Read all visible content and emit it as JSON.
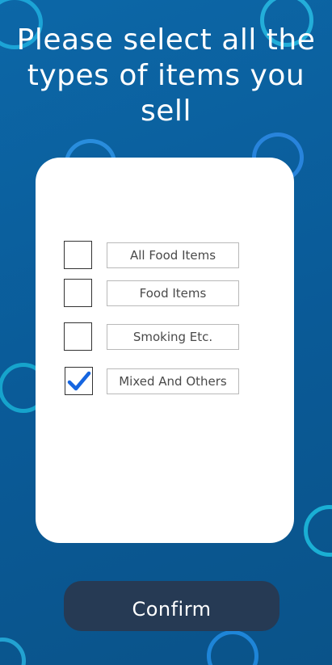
{
  "header": {
    "title": "Please select all the types of items you sell"
  },
  "options": [
    {
      "label": "All Food Items",
      "checked": false
    },
    {
      "label": "Food Items",
      "checked": false
    },
    {
      "label": "Smoking Etc.",
      "checked": false
    },
    {
      "label": "Mixed And Others",
      "checked": true
    }
  ],
  "actions": {
    "confirm_label": "Confirm"
  },
  "colors": {
    "background": "#0b5e9b",
    "ring": "#1fa9d6",
    "card": "#ffffff",
    "checkmark": "#1565e0",
    "confirm_button": "#263a54"
  },
  "icons": {
    "checkmark": "checkmark-icon"
  }
}
